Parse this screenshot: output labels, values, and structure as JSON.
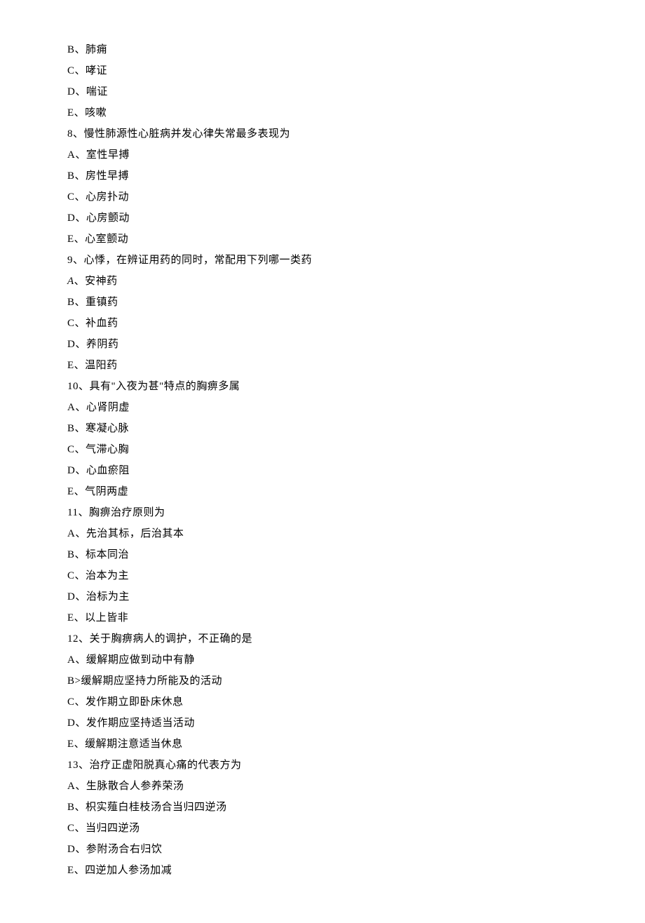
{
  "lines": [
    "B、肺痈",
    "C、哮证",
    "D、喘证",
    "E、咳嗽",
    "8、慢性肺源性心脏病并发心律失常最多表现为",
    "A、室性早搏",
    "B、房性早搏",
    "C、心房扑动",
    "D、心房颤动",
    "E、心室颤动",
    "9、心悸，在辨证用药的同时，常配用下列哪一类药",
    "A、安神药",
    "B、重镇药",
    "C、补血药",
    "D、养阴药",
    "E、温阳药",
    "10、具有\"入夜为甚\"特点的胸痹多属",
    "A、心肾阴虚",
    "B、寒凝心脉",
    "C、气滞心胸",
    "D、心血瘀阻",
    "E、气阴两虚",
    "11、胸痹治疗原则为",
    "A、先治其标，后治其本",
    "B、标本同治",
    "C、治本为主",
    "D、治标为主",
    "E、以上皆非",
    "12、关于胸痹病人的调护，不正确的是",
    "A、缓解期应做到动中有静",
    "B>缓解期应坚持力所能及的活动",
    "C、发作期立即卧床休息",
    "D、发作期应坚持适当活动",
    "E、缓解期注意适当休息",
    "13、治疗正虚阳脱真心痛的代表方为",
    "A、生脉散合人参养荣汤",
    "B、枳实薤白桂枝汤合当归四逆汤",
    "C、当归四逆汤",
    "D、参附汤合右归饮",
    "E、四逆加人参汤加减"
  ],
  "italic_line_index": 11
}
